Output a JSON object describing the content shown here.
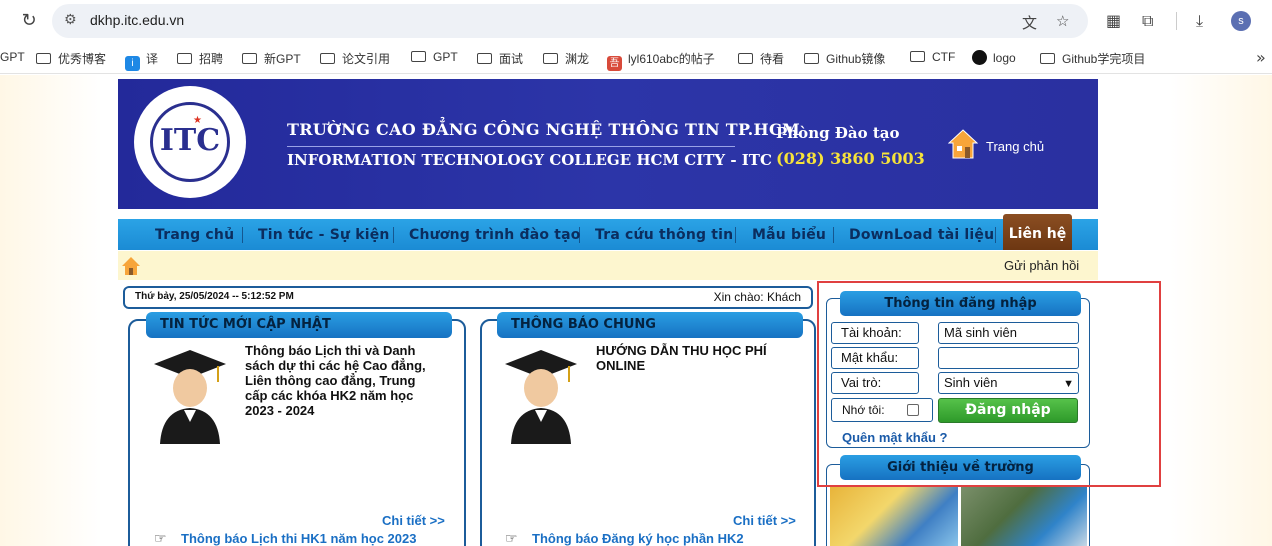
{
  "browser": {
    "url": "dkhp.itc.edu.vn",
    "profile_initial": "s",
    "bookmarks": [
      "GPT",
      "优秀博客",
      "译",
      "招聘",
      "新GPT",
      "论文引用",
      "GPT",
      "面试",
      "渊龙",
      "lyl610abc的帖子",
      "待看",
      "Github镜像",
      "CTF",
      "logo",
      "Github学完项目"
    ]
  },
  "header": {
    "school_name_vi": "TRƯỜNG CAO ĐẲNG CÔNG NGHỆ THÔNG TIN TP.HCM",
    "school_name_en": "INFORMATION TECHNOLOGY COLLEGE HCM CITY - ITC",
    "department": "Phòng Đào tạo",
    "phone": "(028) 3860 5003",
    "home_link": "Trang chủ",
    "logo_letters": "ITC"
  },
  "menu": {
    "items": [
      "Trang chủ",
      "Tin tức - Sự kiện",
      "Chương trình đào tạo",
      "Tra cứu thông tin",
      "Mẫu biểu",
      "DownLoad tài liệu"
    ],
    "active": "Liên hệ"
  },
  "crumb": {
    "feedback": "Gửi phản hồi"
  },
  "status": {
    "datetime": "Thứ bảy, 25/05/2024 -- 5:12:52 PM",
    "greeting": "Xin chào: Khách"
  },
  "news": {
    "title": "TIN TỨC MỚI CẬP NHẬT",
    "item_lines": [
      "Thông báo Lịch thi và Danh",
      "sách dự thi các hệ Cao đẳng,",
      "Liên thông cao đẳng, Trung",
      "cấp các khóa HK2 năm học",
      "2023 - 2024"
    ],
    "detail": "Chi tiết >>",
    "link": "Thông báo Lịch thi HK1 năm học 2023"
  },
  "notice": {
    "title": "THÔNG BÁO CHUNG",
    "item_lines": [
      "HƯỚNG DẪN THU HỌC PHÍ",
      "ONLINE"
    ],
    "detail": "Chi tiết >>",
    "link": "Thông báo Đăng ký học phần HK2"
  },
  "login": {
    "title": "Thông tin đăng nhập",
    "account_label": "Tài khoản:",
    "account_placeholder": "Mã sinh viên",
    "password_label": "Mật khẩu:",
    "role_label": "Vai trò:",
    "role_value": "Sinh viên",
    "remember_label": "Nhớ tôi:",
    "submit": "Đăng nhập",
    "forgot": "Quên mật khẩu ?"
  },
  "intro": {
    "title": "Giới thiệu về trường"
  },
  "colors": {
    "banner": "#2a30a0",
    "menu": "#1b8bd4",
    "active_tab": "#7a4018",
    "highlight": "#e04040"
  }
}
